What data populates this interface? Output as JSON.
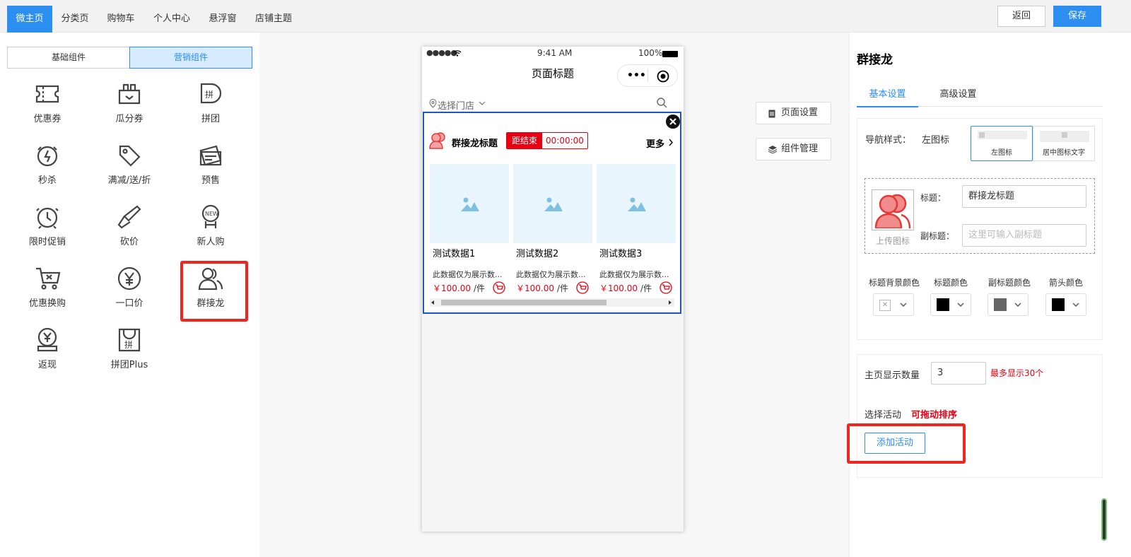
{
  "topbar": {
    "tabs": [
      "微主页",
      "分类页",
      "购物车",
      "个人中心",
      "悬浮窗",
      "店铺主题"
    ],
    "back_label": "返回",
    "save_label": "保存"
  },
  "left": {
    "segments": [
      "基础组件",
      "营销组件"
    ],
    "tools": [
      "优惠券",
      "瓜分券",
      "拼团",
      "秒杀",
      "满减/送/折",
      "预售",
      "限时促销",
      "砍价",
      "新人购",
      "优惠换购",
      "一口价",
      "群接龙",
      "返现",
      "拼团Plus"
    ]
  },
  "phone": {
    "status_time": "9:41 AM",
    "status_signal": "●●●●●",
    "status_battery": "100%",
    "page_title": "页面标题",
    "store_select": "选择门店",
    "component": {
      "title": "群接龙标题",
      "countdown_label": "距结束",
      "countdown_value": "00:00:00",
      "more_label": "更多",
      "products": [
        {
          "name": "测试数据1",
          "desc": "此数据仅为展示数...",
          "price": "￥100.00",
          "unit": "/件"
        },
        {
          "name": "测试数据2",
          "desc": "此数据仅为展示数...",
          "price": "￥100.00",
          "unit": "/件"
        },
        {
          "name": "测试数据3",
          "desc": "此数据仅为展示数...",
          "price": "￥100.00",
          "unit": "/件"
        }
      ]
    }
  },
  "center": {
    "page_settings_label": "页面设置",
    "component_manage_label": "组件管理"
  },
  "right": {
    "panel_title": "群接龙",
    "tabs": [
      "基本设置",
      "高级设置"
    ],
    "nav_style_label": "导航样式：",
    "nav_style_value": "左图标",
    "nav_option_left": "左图标",
    "nav_option_center": "居中图标文字",
    "upload_icon_label": "上传图标",
    "title_label": "标题：",
    "title_value": "群接龙标题",
    "subtitle_label": "副标题：",
    "subtitle_placeholder": "这里可输入副标题",
    "color_labels": [
      "标题背景颜色",
      "标题颜色",
      "副标题颜色",
      "箭头颜色"
    ],
    "colors": {
      "title": "#000000",
      "subtitle": "#666666",
      "arrow": "#000000"
    },
    "count_label": "主页显示数量",
    "count_value": "3",
    "count_hint": "最多显示30个",
    "select_activity_label": "选择活动",
    "drag_hint": "可拖动排序",
    "add_activity_label": "添加活动"
  },
  "colors": {
    "accent": "#2b8ef0",
    "red": "#e60012",
    "highlight": "#f0261e"
  }
}
